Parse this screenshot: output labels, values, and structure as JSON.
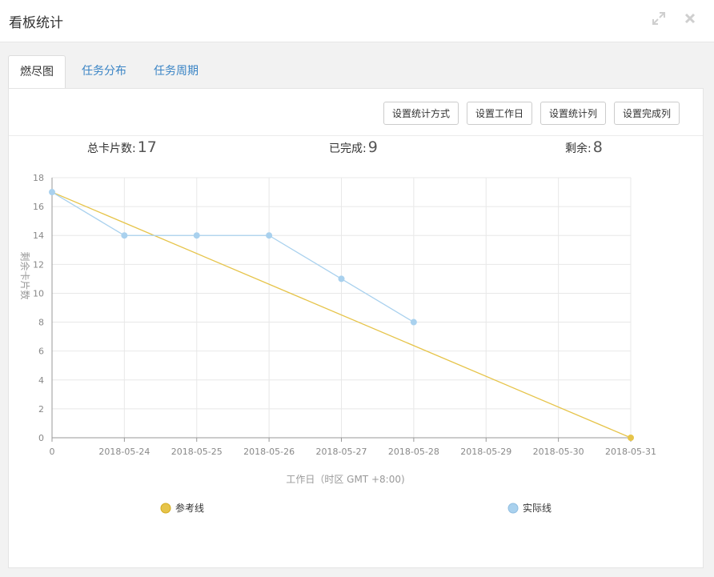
{
  "window": {
    "title": "看板统计",
    "icons": {
      "expand": "expand-icon",
      "close": "close-icon"
    }
  },
  "tabs": [
    {
      "label": "燃尽图",
      "active": true
    },
    {
      "label": "任务分布",
      "active": false
    },
    {
      "label": "任务周期",
      "active": false
    }
  ],
  "toolbar": {
    "stat_method": "设置统计方式",
    "workday": "设置工作日",
    "stat_column": "设置统计列",
    "done_column": "设置完成列"
  },
  "stats": {
    "total_label": "总卡片数:",
    "total_value": "17",
    "done_label": "已完成:",
    "done_value": "9",
    "remaining_label": "剩余:",
    "remaining_value": "8"
  },
  "chart_data": {
    "type": "line",
    "xlabel": "工作日（时区 GMT +8:00)",
    "ylabel": "剩余卡片数",
    "x_ticks": [
      "0",
      "2018-05-24",
      "2018-05-25",
      "2018-05-26",
      "2018-05-27",
      "2018-05-28",
      "2018-05-29",
      "2018-05-30",
      "2018-05-31"
    ],
    "ylim": [
      0,
      18
    ],
    "y_ticks": [
      0,
      2,
      4,
      6,
      8,
      10,
      12,
      14,
      16,
      18
    ],
    "grid": true,
    "legend_position": "bottom",
    "series": [
      {
        "name": "参考线",
        "color": "#e6c44a",
        "points": [
          [
            0,
            17
          ],
          [
            8,
            0
          ]
        ]
      },
      {
        "name": "实际线",
        "color": "#a9d1ee",
        "points": [
          [
            0,
            17
          ],
          [
            1,
            14
          ],
          [
            2,
            14
          ],
          [
            3,
            14
          ],
          [
            4,
            11
          ],
          [
            5,
            8
          ]
        ]
      }
    ]
  }
}
